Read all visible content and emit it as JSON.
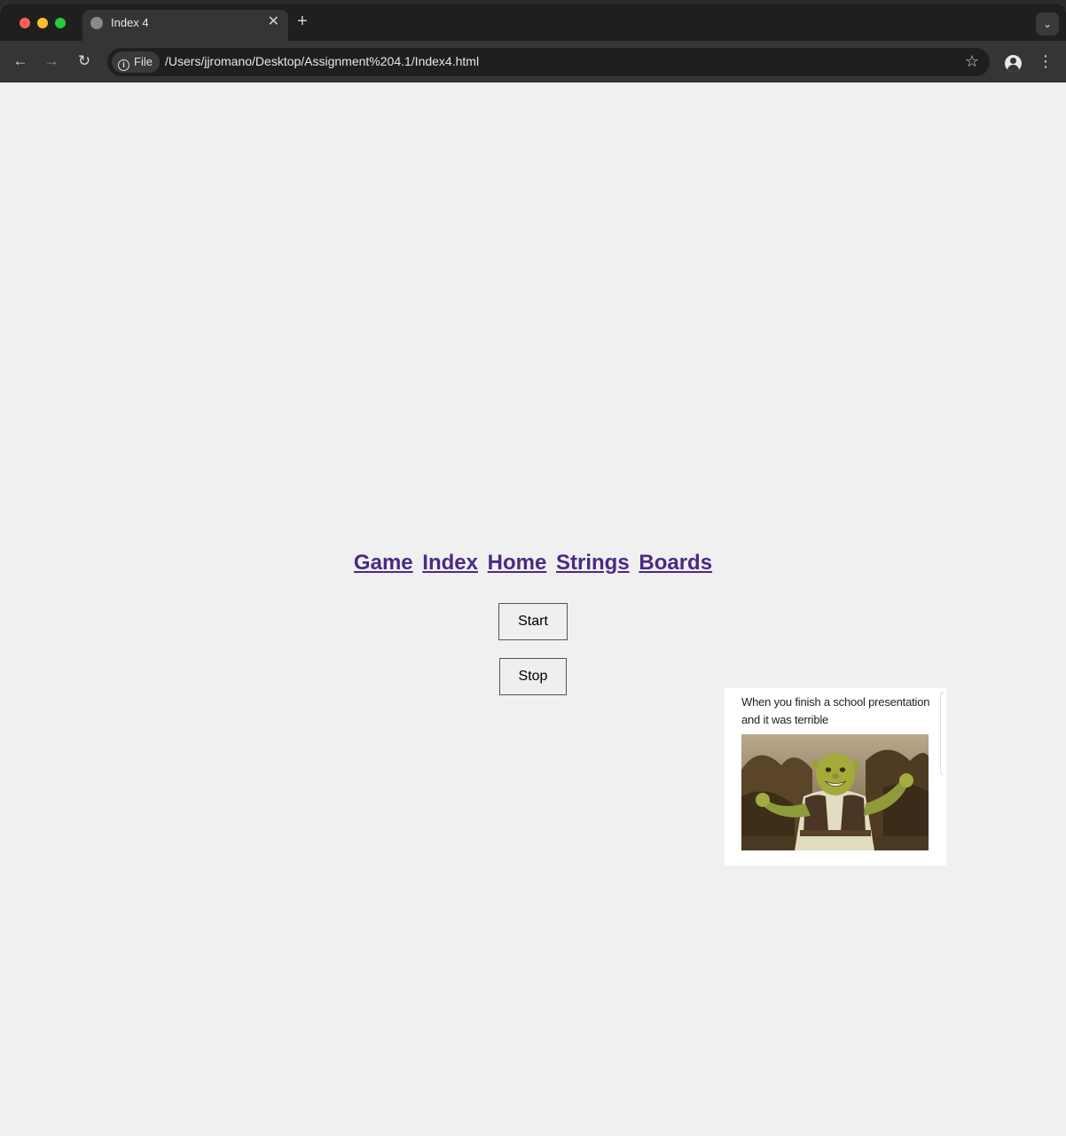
{
  "browser": {
    "tab_title": "Index 4",
    "close_tab_glyph": "✕",
    "new_tab_glyph": "+",
    "tab_menu_glyph": "⌄",
    "back_glyph": "←",
    "forward_glyph": "→",
    "reload_glyph": "↻",
    "security_chip_label": "File",
    "url": "/Users/jjromano/Desktop/Assignment%204.1/Index4.html",
    "bookmark_glyph": "☆",
    "menu_glyph": "⋮"
  },
  "page": {
    "nav_links": [
      "Game",
      "Index",
      "Home",
      "Strings",
      "Boards"
    ],
    "start_button_label": "Start",
    "stop_button_label": "Stop",
    "meme_caption": "When you finish a school presentation and it was terrible",
    "link_color": "#4b2a85",
    "background_color": "#f0f0f0"
  }
}
